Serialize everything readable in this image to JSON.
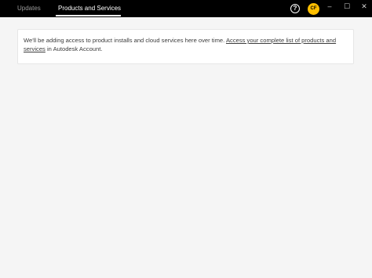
{
  "header": {
    "tabs": [
      {
        "label": "Updates",
        "active": false
      },
      {
        "label": "Products and Services",
        "active": true
      }
    ],
    "help_icon_glyph": "?",
    "avatar_initials": "CF",
    "window_controls": {
      "minimize_glyph": "–",
      "maximize_glyph": "☐",
      "close_glyph": "✕"
    }
  },
  "main": {
    "notice_text": "We'll be adding access to product installs and cloud services here over time. ",
    "notice_link": "Access your complete list of products and services",
    "notice_suffix": " in Autodesk Account."
  },
  "colors": {
    "topbar": "#000000",
    "avatar": "#ffbf00",
    "background": "#f5f5f5",
    "card": "#ffffff"
  }
}
